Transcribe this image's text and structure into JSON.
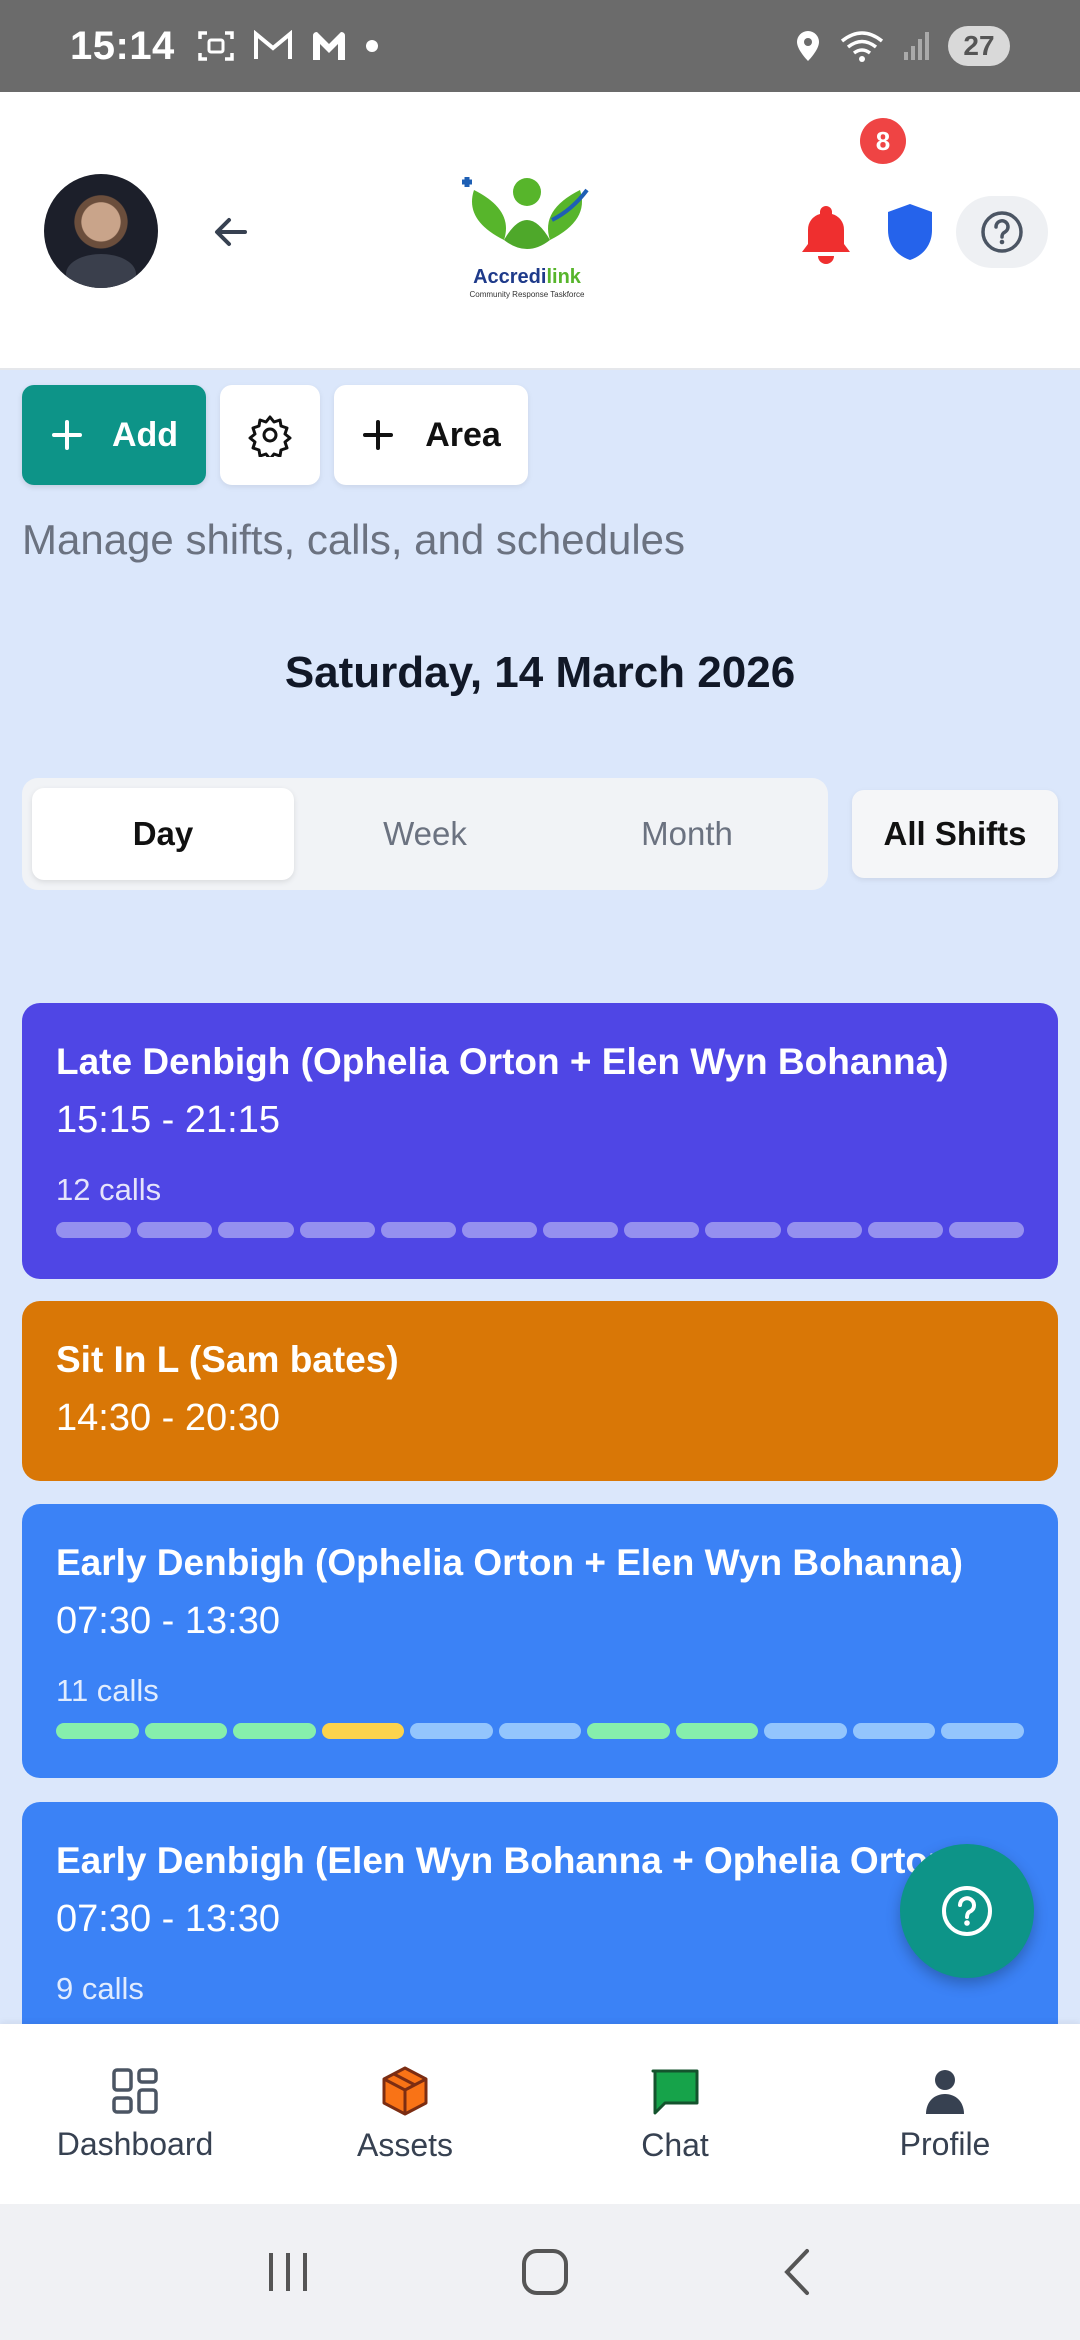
{
  "status_bar": {
    "time": "15:14",
    "battery": "27"
  },
  "header": {
    "notification_count": "8",
    "logo_name_main": "Accredi",
    "logo_name_accent": "link",
    "logo_tagline": "Community Response Taskforce"
  },
  "toolbar": {
    "add_label": "Add",
    "area_label": "Area"
  },
  "subtitle": "Manage shifts, calls, and schedules",
  "date": "Saturday, 14 March 2026",
  "view_tabs": [
    {
      "label": "Day",
      "active": true
    },
    {
      "label": "Week",
      "active": false
    },
    {
      "label": "Month",
      "active": false
    }
  ],
  "filter_label": "All Shifts",
  "shifts": [
    {
      "title": "Late Denbigh (Ophelia Orton + Elen Wyn Bohanna)",
      "time": "15:15 - 21:15",
      "calls": "12 calls",
      "color": "#4f46e5"
    },
    {
      "title": "Sit In L (Sam bates)",
      "time": "14:30 - 20:30",
      "calls": "",
      "color": "#d97706"
    },
    {
      "title": "Early Denbigh (Ophelia Orton + Elen Wyn Bohanna)",
      "time": "07:30 - 13:30",
      "calls": "11 calls",
      "color": "#3b82f6"
    },
    {
      "title": "Early Denbigh (Elen Wyn Bohanna + Ophelia Orton)",
      "time": "07:30 - 13:30",
      "calls": "9 calls",
      "color": "#3b82f6"
    }
  ],
  "call_bar_colors_shift3": [
    "#86efac",
    "#86efac",
    "#86efac",
    "#fcd34d",
    "#93c5fd",
    "#93c5fd",
    "#86efac",
    "#86efac",
    "#93c5fd",
    "#93c5fd",
    "#93c5fd"
  ],
  "bottom_nav": [
    {
      "label": "Dashboard",
      "icon": "dashboard-icon"
    },
    {
      "label": "Assets",
      "icon": "box-icon"
    },
    {
      "label": "Chat",
      "icon": "chat-icon"
    },
    {
      "label": "Profile",
      "icon": "person-icon"
    }
  ],
  "colors": {
    "teal": "#0d9488",
    "alert_red": "#ef4444",
    "shield_blue": "#2563eb",
    "page_bg": "#dbe7fb"
  }
}
